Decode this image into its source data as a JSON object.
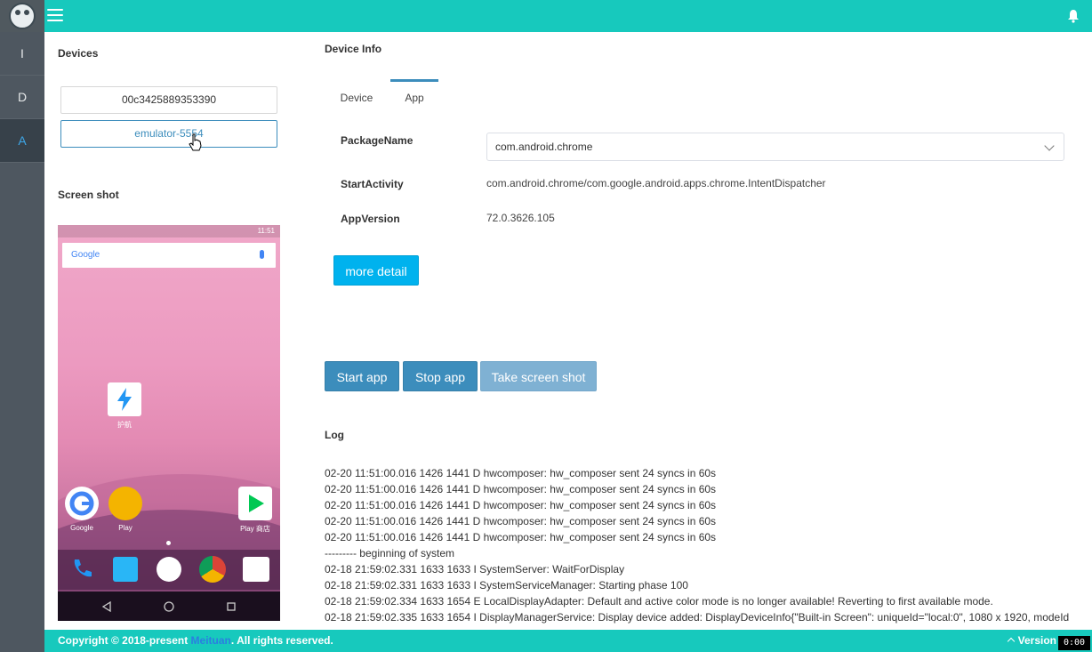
{
  "topbar": {
    "menu_icon": "hamburger-icon",
    "notify_icon": "bell-icon"
  },
  "nav": {
    "items": [
      {
        "label": "I"
      },
      {
        "label": "D"
      },
      {
        "label": "A"
      }
    ],
    "active": "A"
  },
  "devices": {
    "title": "Devices",
    "list": [
      {
        "label": "00c3425889353390"
      },
      {
        "label": "emulator-5554"
      }
    ],
    "selected": "emulator-5554"
  },
  "screenshot": {
    "title": "Screen shot",
    "phone": {
      "time": "11:51",
      "search_brand": "Google",
      "home_app_label": "护航",
      "apps": [
        {
          "label": "Google"
        },
        {
          "label": "Play"
        },
        {
          "label": "Play 商店"
        }
      ]
    }
  },
  "device_info": {
    "title": "Device Info",
    "tabs": [
      {
        "label": "Device"
      },
      {
        "label": "App"
      }
    ],
    "active_tab": "App",
    "package_label": "PackageName",
    "package_value": "com.android.chrome",
    "activity_label": "StartActivity",
    "activity_value": "com.android.chrome/com.google.android.apps.chrome.IntentDispatcher",
    "version_label": "AppVersion",
    "version_value": "72.0.3626.105",
    "more_detail": "more detail"
  },
  "actions": {
    "start": "Start app",
    "stop": "Stop app",
    "screenshot": "Take screen shot"
  },
  "log": {
    "title": "Log",
    "lines": [
      "02-20 11:51:00.016 1426 1441 D hwcomposer: hw_composer sent 24 syncs in 60s",
      "02-20 11:51:00.016 1426 1441 D hwcomposer: hw_composer sent 24 syncs in 60s",
      "02-20 11:51:00.016 1426 1441 D hwcomposer: hw_composer sent 24 syncs in 60s",
      "02-20 11:51:00.016 1426 1441 D hwcomposer: hw_composer sent 24 syncs in 60s",
      "02-20 11:51:00.016 1426 1441 D hwcomposer: hw_composer sent 24 syncs in 60s",
      "--------- beginning of system",
      "02-18 21:59:02.331 1633 1633 I SystemServer: WaitForDisplay",
      "02-18 21:59:02.331 1633 1633 I SystemServiceManager: Starting phase 100",
      "02-18 21:59:02.334 1633 1654 E LocalDisplayAdapter: Default and active color mode is no longer available! Reverting to first available mode.",
      "02-18 21:59:02.335 1633 1654 I DisplayManagerService: Display device added: DisplayDeviceInfo{\"Built-in Screen\": uniqueId=\"local:0\", 1080 x 1920, modeId"
    ]
  },
  "footer": {
    "copyright_prefix": "Copyright © 2018-present ",
    "brand": "Meituan",
    "copyright_suffix": ". All rights reserved.",
    "version": "Version"
  },
  "timer": "0:00"
}
